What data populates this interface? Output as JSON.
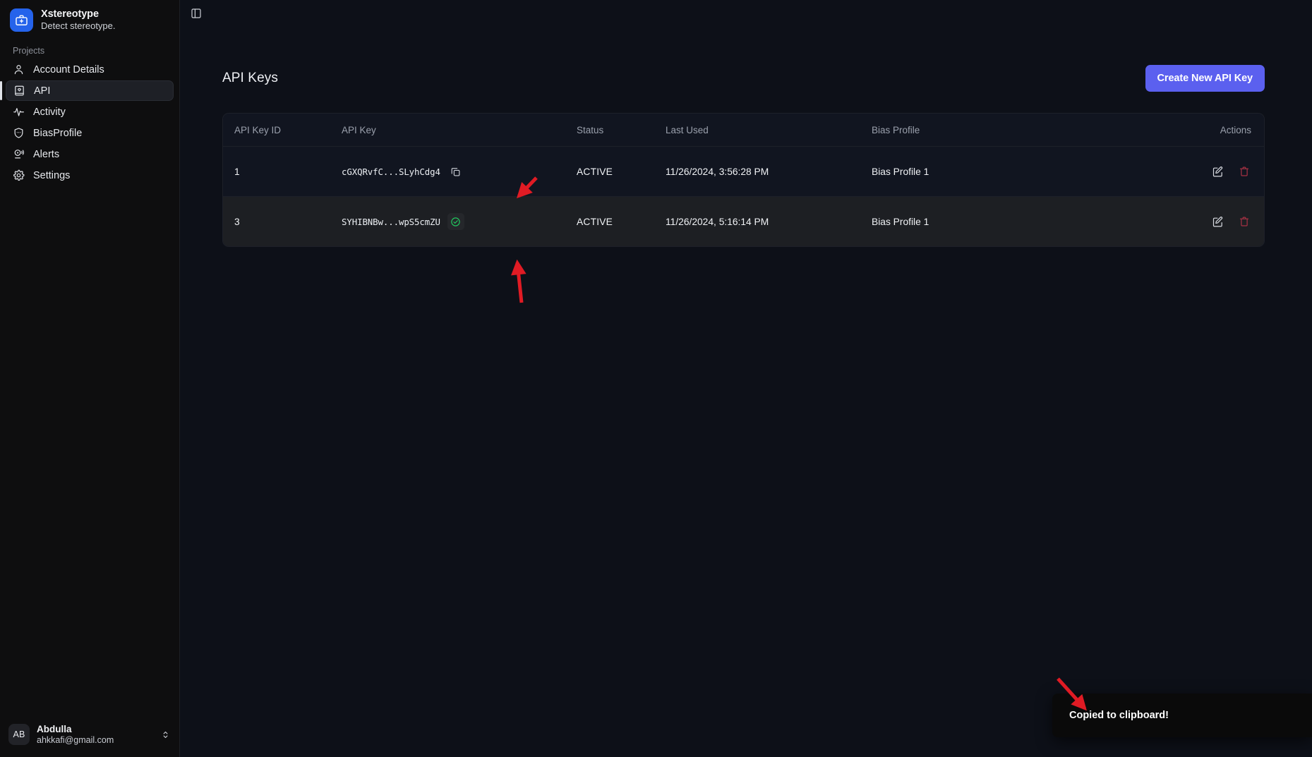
{
  "brand": {
    "title": "Xstereotype",
    "subtitle": "Detect stereotype.",
    "logo_icon": "medical-briefcase-icon",
    "accent_color": "#2563eb"
  },
  "sidebar": {
    "section_label": "Projects",
    "items": [
      {
        "label": "Account Details",
        "icon": "user-icon",
        "active": false
      },
      {
        "label": "API",
        "icon": "api-book-icon",
        "active": true
      },
      {
        "label": "Activity",
        "icon": "activity-pulse-icon",
        "active": false
      },
      {
        "label": "BiasProfile",
        "icon": "shield-icon",
        "active": false
      },
      {
        "label": "Alerts",
        "icon": "bell-alert-icon",
        "active": false
      },
      {
        "label": "Settings",
        "icon": "gear-icon",
        "active": false
      }
    ],
    "user": {
      "initials": "AB",
      "name": "Abdulla",
      "email": "ahkkafi@gmail.com",
      "chevron_icon": "chevron-up-down-icon"
    }
  },
  "topbar": {
    "panel_toggle_icon": "sidebar-toggle-icon"
  },
  "main": {
    "page_title": "API Keys",
    "create_button_label": "Create New API Key",
    "create_button_color": "#5b60ef",
    "table": {
      "columns": [
        "API Key ID",
        "API Key",
        "Status",
        "Last Used",
        "Bias Profile",
        "Actions"
      ],
      "rows": [
        {
          "id": "1",
          "api_key": "cGXQRvfC...SLyhCdg4",
          "copy_state": "idle",
          "copy_icon": "copy-icon",
          "status": "ACTIVE",
          "last_used": "11/26/2024, 3:56:28 PM",
          "bias_profile": "Bias Profile 1",
          "edit_icon": "edit-pencil-icon",
          "delete_icon": "trash-icon"
        },
        {
          "id": "3",
          "api_key": "SYHIBNBw...wpS5cmZU",
          "copy_state": "copied",
          "copy_icon": "check-circle-icon",
          "status": "ACTIVE",
          "last_used": "11/26/2024, 5:16:14 PM",
          "bias_profile": "Bias Profile 1",
          "edit_icon": "edit-pencil-icon",
          "delete_icon": "trash-icon"
        }
      ]
    }
  },
  "toast": {
    "message": "Copied to clipboard!",
    "background": "#0a0a0a"
  },
  "annotations": {
    "arrow_color": "#e01b24",
    "arrows": [
      {
        "name": "arrow-to-copy-button",
        "target": "copy-icon-row-1"
      },
      {
        "name": "arrow-to-copied-check",
        "target": "check-circle-icon-row-3"
      },
      {
        "name": "arrow-to-toast",
        "target": "toast"
      }
    ]
  }
}
